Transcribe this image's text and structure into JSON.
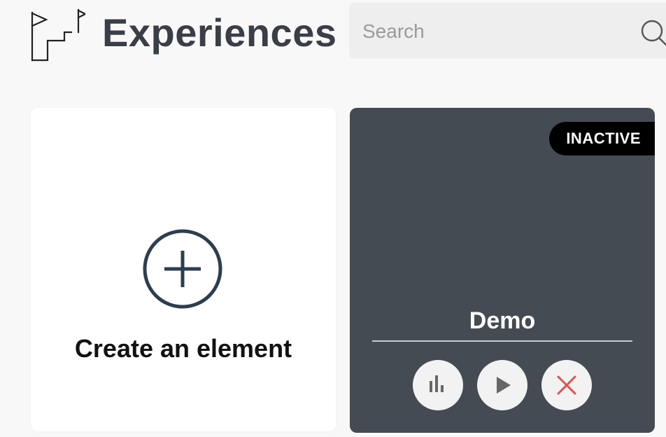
{
  "header": {
    "title": "Experiences",
    "logo_icon": "flags-stairs-logo"
  },
  "search": {
    "placeholder": "Search",
    "icon": "search-icon"
  },
  "create_card": {
    "label": "Create an element",
    "icon": "plus-circle-icon"
  },
  "experience": {
    "title": "Demo",
    "status": "INACTIVE",
    "actions": [
      {
        "name": "stats",
        "icon": "bar-chart-icon"
      },
      {
        "name": "play",
        "icon": "play-icon"
      },
      {
        "name": "delete",
        "icon": "close-icon",
        "color": "#d9534f"
      }
    ]
  },
  "colors": {
    "background": "#f8f8f8",
    "card_dark": "#454b53",
    "accent_dark": "#2c3e50",
    "delete_red": "#d9534f"
  }
}
